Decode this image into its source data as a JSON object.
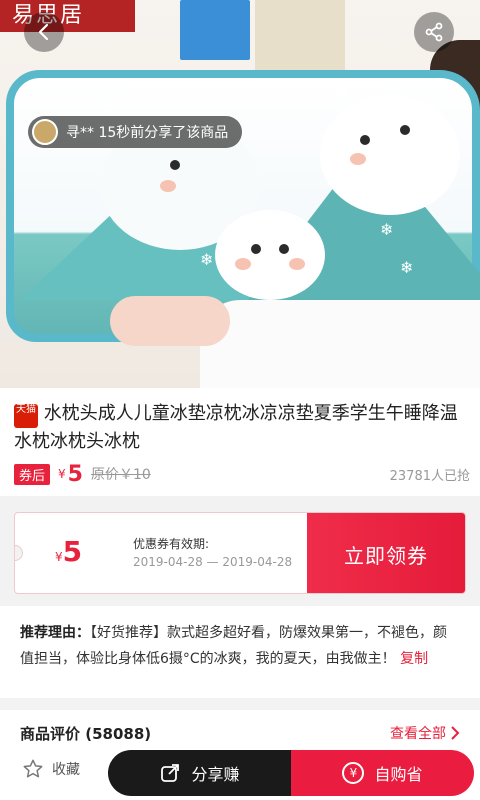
{
  "hero": {
    "logo_text": "易思居",
    "share_tip": "寻** 15秒前分享了该商品"
  },
  "product": {
    "platform_badge": "天猫",
    "title": "水枕头成人儿童冰垫凉枕冰凉凉垫夏季学生午睡降温水枕冰枕头冰枕",
    "after_tag": "券后",
    "price_yen": "¥",
    "price": "5",
    "original_price": "原价￥10",
    "grabbed": "23781人已抢"
  },
  "coupon": {
    "yen": "¥",
    "amount": "5",
    "valid_label": "优惠券有效期:",
    "date_range": "2019-04-28 — 2019-04-28",
    "button": "立即领券"
  },
  "reason": {
    "label": "推荐理由：",
    "text": "【好货推荐】款式超多超好看，防爆效果第一，不褪色，颜值担当，体验比身体低6摄°C的冰爽，我的夏天，由我做主！",
    "copy_link": "复制"
  },
  "reviews": {
    "title": "商品评价 (58088)",
    "more": "查看全部"
  },
  "bottom": {
    "fav_label": "收藏",
    "share_label": "分享赚",
    "buy_label": "自购省",
    "buy_icon_glyph": "¥"
  },
  "colors": {
    "accent": "#e8213c",
    "dark_button": "#1a1a1a"
  }
}
